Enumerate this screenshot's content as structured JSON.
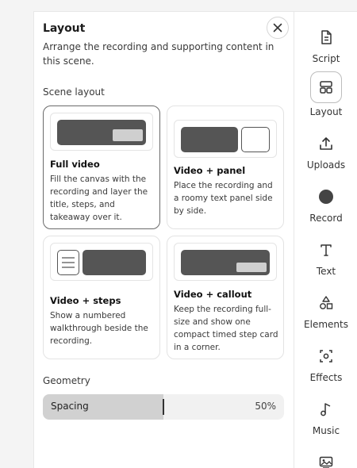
{
  "panel": {
    "title": "Layout",
    "subtitle": "Arrange the recording and supporting content in this scene.",
    "close_icon": "close-icon"
  },
  "scene_layout": {
    "label": "Scene layout",
    "cards": [
      {
        "title": "Full video",
        "description": "Fill the canvas with the recording and layer the title, steps, and takeaway over it.",
        "selected": true
      },
      {
        "title": "Video + panel",
        "description": "Place the recording and a roomy text panel side by side.",
        "selected": false
      },
      {
        "title": "Video + steps",
        "description": "Show a numbered walkthrough beside the recording.",
        "selected": false
      },
      {
        "title": "Video + callout",
        "description": "Keep the recording full-size and show one compact timed step card in a corner.",
        "selected": false
      }
    ]
  },
  "geometry": {
    "label": "Geometry",
    "spacing_label": "Spacing",
    "spacing_value": "50%",
    "spacing_fraction": 0.5
  },
  "rail": {
    "items": [
      {
        "label": "Script",
        "icon": "document-icon",
        "active": false
      },
      {
        "label": "Layout",
        "icon": "layout-icon",
        "active": true
      },
      {
        "label": "Uploads",
        "icon": "upload-icon",
        "active": false
      },
      {
        "label": "Record",
        "icon": "record-icon",
        "active": false
      },
      {
        "label": "Text",
        "icon": "text-icon",
        "active": false
      },
      {
        "label": "Elements",
        "icon": "shapes-icon",
        "active": false
      },
      {
        "label": "Effects",
        "icon": "effects-icon",
        "active": false
      },
      {
        "label": "Music",
        "icon": "music-note-icon",
        "active": false
      },
      {
        "label": "",
        "icon": "media-icon",
        "active": false
      }
    ]
  },
  "colors": {
    "thumbnail_dark": "#555555",
    "thumbnail_light": "#cfcfcf",
    "slider_fill": "#d1d1d1"
  }
}
